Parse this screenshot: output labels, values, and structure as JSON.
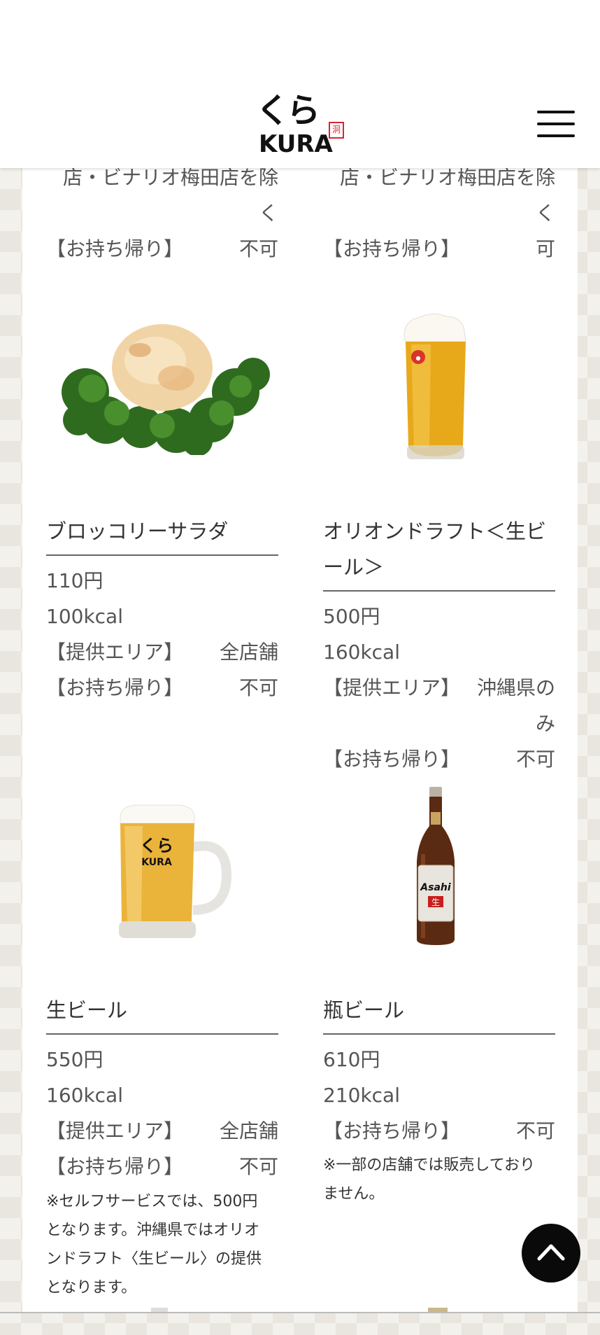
{
  "header": {
    "logo_jp": "くら",
    "logo_en": "KURA",
    "logo_seal": "洞",
    "menu_icon": "hamburger-icon"
  },
  "partial_top": [
    {
      "area_text_tail": "店・ビナリオ梅田店を除",
      "area_text_end": "く",
      "takeout_label": "【お持ち帰り】",
      "takeout_value": "不可"
    },
    {
      "area_text_tail": "店・ビナリオ梅田店を除",
      "area_text_end": "く",
      "takeout_label": "【お持ち帰り】",
      "takeout_value": "可"
    }
  ],
  "items": [
    {
      "name": "ブロッコリーサラダ",
      "price": "110円",
      "kcal": "100kcal",
      "area_label": "【提供エリア】",
      "area_value": "全店舗",
      "takeout_label": "【お持ち帰り】",
      "takeout_value": "不可",
      "image": "broccoli-salad"
    },
    {
      "name_line1": "オリオンドラフト＜生ビ",
      "name_line2": "ール＞",
      "price": "500円",
      "kcal": "160kcal",
      "area_label": "【提供エリア】",
      "area_value_line1": "沖縄県の",
      "area_value_line2": "み",
      "takeout_label": "【お持ち帰り】",
      "takeout_value": "不可",
      "image": "orion-draft-mug"
    },
    {
      "name": "生ビール",
      "price": "550円",
      "kcal": "160kcal",
      "area_label": "【提供エリア】",
      "area_value": "全店舗",
      "takeout_label": "【お持ち帰り】",
      "takeout_value": "不可",
      "note_lines": [
        "※セルフサービスでは、500円",
        "となります。沖縄県ではオリオ",
        "ンドラフト〈生ビール〉の提供",
        "となります。"
      ],
      "image": "kura-beer-mug",
      "mug_logo_jp": "くら",
      "mug_logo_en": "KURA"
    },
    {
      "name": "瓶ビール",
      "price": "610円",
      "kcal": "210kcal",
      "takeout_label": "【お持ち帰り】",
      "takeout_value": "不可",
      "note_lines": [
        "※一部の店舗では販売しており",
        "ません。"
      ],
      "image": "asahi-bottle",
      "bottle_label": "Asahi",
      "bottle_sub": "生"
    }
  ],
  "scroll_top": {
    "icon": "chevron-up-icon"
  }
}
